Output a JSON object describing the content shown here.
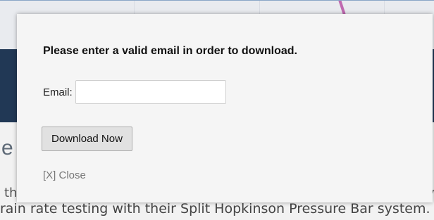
{
  "modal": {
    "title": "Please enter a valid email in order to download.",
    "email_label": "Email:",
    "email_value": "",
    "email_placeholder": "",
    "download_button_label": "Download Now",
    "close_link_label": "[X] Close"
  },
  "background": {
    "heading_fragment": "e",
    "text_fragment_left": "th",
    "text_fragment_right": "v",
    "bottom_line_text": "rain rate testing with their Split Hopkinson Pressure Bar system. Due"
  },
  "colors": {
    "band": "#213855",
    "modal_background": "#f5f5f5",
    "button_background": "#e1e1e1",
    "close_link": "#777777"
  }
}
